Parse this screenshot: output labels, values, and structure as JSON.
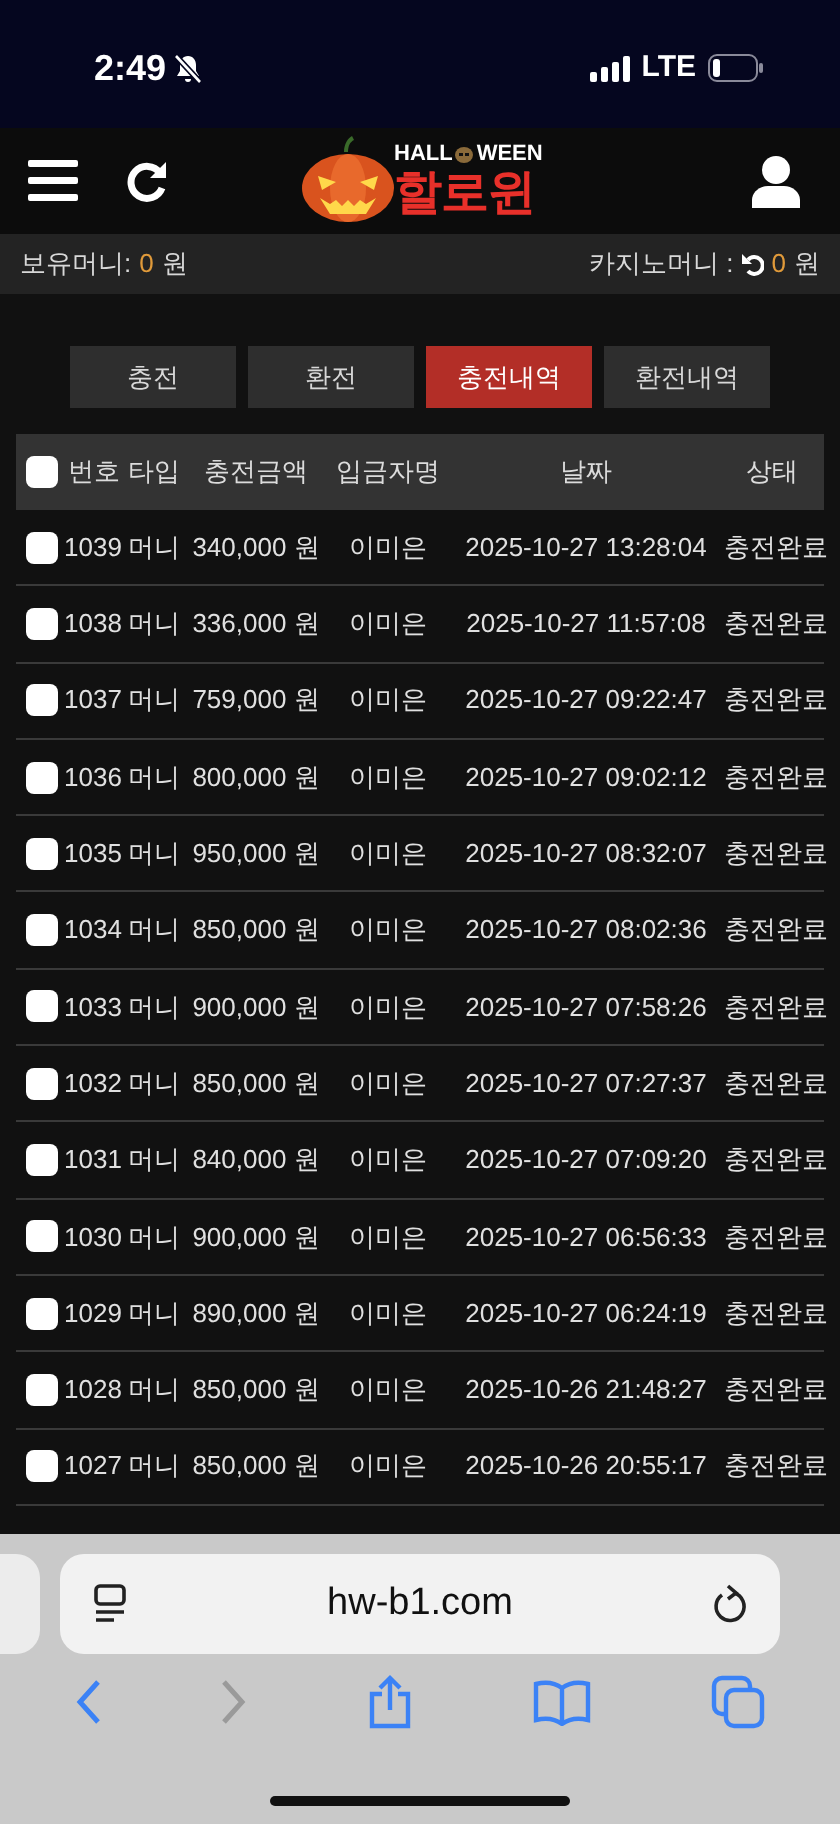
{
  "status_bar": {
    "time": "2:49",
    "network": "LTE"
  },
  "header": {
    "logo_top_left": "HALL",
    "logo_top_right": "WEEN",
    "logo_main": "할로윈"
  },
  "balance_bar": {
    "left_label": "보유머니:",
    "left_amount": "0",
    "left_unit": "원",
    "right_label": "카지노머니 :",
    "right_amount": "0",
    "right_unit": "원"
  },
  "tabs": [
    {
      "label": "충전",
      "selected": false
    },
    {
      "label": "환전",
      "selected": false
    },
    {
      "label": "충전내역",
      "selected": true
    },
    {
      "label": "환전내역",
      "selected": false
    }
  ],
  "table": {
    "select_all_checked": false,
    "columns": [
      "번호",
      "타입",
      "충전금액",
      "입금자명",
      "날짜",
      "상태"
    ],
    "rows": [
      {
        "checked": false,
        "number": "1039",
        "type": "머니",
        "amount": "340,000 원",
        "depositor": "이미은",
        "date": "2025-10-27 13:28:04",
        "status": "충전완료"
      },
      {
        "checked": false,
        "number": "1038",
        "type": "머니",
        "amount": "336,000 원",
        "depositor": "이미은",
        "date": "2025-10-27 11:57:08",
        "status": "충전완료"
      },
      {
        "checked": false,
        "number": "1037",
        "type": "머니",
        "amount": "759,000 원",
        "depositor": "이미은",
        "date": "2025-10-27 09:22:47",
        "status": "충전완료"
      },
      {
        "checked": false,
        "number": "1036",
        "type": "머니",
        "amount": "800,000 원",
        "depositor": "이미은",
        "date": "2025-10-27 09:02:12",
        "status": "충전완료"
      },
      {
        "checked": false,
        "number": "1035",
        "type": "머니",
        "amount": "950,000 원",
        "depositor": "이미은",
        "date": "2025-10-27 08:32:07",
        "status": "충전완료"
      },
      {
        "checked": false,
        "number": "1034",
        "type": "머니",
        "amount": "850,000 원",
        "depositor": "이미은",
        "date": "2025-10-27 08:02:36",
        "status": "충전완료"
      },
      {
        "checked": false,
        "number": "1033",
        "type": "머니",
        "amount": "900,000 원",
        "depositor": "이미은",
        "date": "2025-10-27 07:58:26",
        "status": "충전완료"
      },
      {
        "checked": false,
        "number": "1032",
        "type": "머니",
        "amount": "850,000 원",
        "depositor": "이미은",
        "date": "2025-10-27 07:27:37",
        "status": "충전완료"
      },
      {
        "checked": false,
        "number": "1031",
        "type": "머니",
        "amount": "840,000 원",
        "depositor": "이미은",
        "date": "2025-10-27 07:09:20",
        "status": "충전완료"
      },
      {
        "checked": false,
        "number": "1030",
        "type": "머니",
        "amount": "900,000 원",
        "depositor": "이미은",
        "date": "2025-10-27 06:56:33",
        "status": "충전완료"
      },
      {
        "checked": false,
        "number": "1029",
        "type": "머니",
        "amount": "890,000 원",
        "depositor": "이미은",
        "date": "2025-10-27 06:24:19",
        "status": "충전완료"
      },
      {
        "checked": false,
        "number": "1028",
        "type": "머니",
        "amount": "850,000 원",
        "depositor": "이미은",
        "date": "2025-10-26 21:48:27",
        "status": "충전완료"
      },
      {
        "checked": false,
        "number": "1027",
        "type": "머니",
        "amount": "850,000 원",
        "depositor": "이미은",
        "date": "2025-10-26 20:55:17",
        "status": "충전완료"
      }
    ]
  },
  "browser": {
    "url": "hw-b1.com"
  }
}
